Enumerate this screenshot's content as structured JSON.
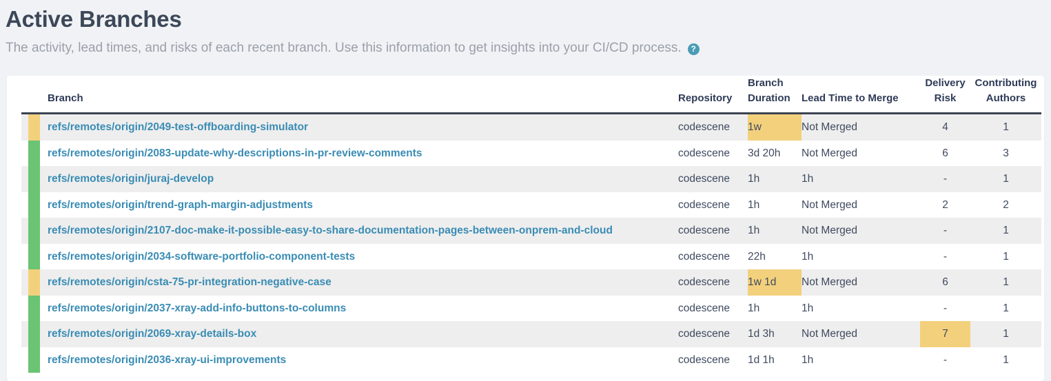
{
  "header": {
    "title": "Active Branches",
    "subtitle": "The activity, lead times, and risks of each recent branch. Use this information to get insights into your CI/CD process.",
    "help_icon": "help-circle-icon",
    "help_glyph": "?"
  },
  "colors": {
    "page_background": "#f1f2f6",
    "card_background": "#ffffff",
    "title": "#3c4858",
    "subtitle": "#9a9fa8",
    "link": "#3a8cb4",
    "header_text": "#2f3b57",
    "header_rule": "#3b4251",
    "status_amber": "#f3d07c",
    "status_green": "#6bc473",
    "highlight_amber": "#f3d07c",
    "row_odd": "#eeeeee",
    "row_even": "#ffffff",
    "help_icon": "#4a9cb5"
  },
  "table": {
    "columns": [
      {
        "key": "status",
        "label": ""
      },
      {
        "key": "branch",
        "label": "Branch"
      },
      {
        "key": "repository",
        "label": "Repository"
      },
      {
        "key": "branch_duration",
        "label": "Branch Duration"
      },
      {
        "key": "lead_time",
        "label": "Lead Time to Merge"
      },
      {
        "key": "delivery_risk",
        "label": "Delivery Risk"
      },
      {
        "key": "contributing_authors",
        "label": "Contributing Authors"
      }
    ],
    "rows": [
      {
        "status": "amber",
        "branch": "refs/remotes/origin/2049-test-offboarding-simulator",
        "repository": "codescene",
        "branch_duration": "1w",
        "branch_duration_highlighted": true,
        "lead_time": "Not Merged",
        "delivery_risk": "4",
        "delivery_risk_highlighted": false,
        "contributing_authors": "1"
      },
      {
        "status": "green",
        "branch": "refs/remotes/origin/2083-update-why-descriptions-in-pr-review-comments",
        "repository": "codescene",
        "branch_duration": "3d 20h",
        "branch_duration_highlighted": false,
        "lead_time": "Not Merged",
        "delivery_risk": "6",
        "delivery_risk_highlighted": false,
        "contributing_authors": "3"
      },
      {
        "status": "green",
        "branch": "refs/remotes/origin/juraj-develop",
        "repository": "codescene",
        "branch_duration": "1h",
        "branch_duration_highlighted": false,
        "lead_time": "1h",
        "delivery_risk": "-",
        "delivery_risk_highlighted": false,
        "contributing_authors": "1"
      },
      {
        "status": "green",
        "branch": "refs/remotes/origin/trend-graph-margin-adjustments",
        "repository": "codescene",
        "branch_duration": "1h",
        "branch_duration_highlighted": false,
        "lead_time": "Not Merged",
        "delivery_risk": "2",
        "delivery_risk_highlighted": false,
        "contributing_authors": "2"
      },
      {
        "status": "green",
        "branch": "refs/remotes/origin/2107-doc-make-it-possible-easy-to-share-documentation-pages-between-onprem-and-cloud",
        "repository": "codescene",
        "branch_duration": "1h",
        "branch_duration_highlighted": false,
        "lead_time": "Not Merged",
        "delivery_risk": "-",
        "delivery_risk_highlighted": false,
        "contributing_authors": "1"
      },
      {
        "status": "green",
        "branch": "refs/remotes/origin/2034-software-portfolio-component-tests",
        "repository": "codescene",
        "branch_duration": "22h",
        "branch_duration_highlighted": false,
        "lead_time": "1h",
        "delivery_risk": "-",
        "delivery_risk_highlighted": false,
        "contributing_authors": "1"
      },
      {
        "status": "amber",
        "branch": "refs/remotes/origin/csta-75-pr-integration-negative-case",
        "repository": "codescene",
        "branch_duration": "1w 1d",
        "branch_duration_highlighted": true,
        "lead_time": "Not Merged",
        "delivery_risk": "6",
        "delivery_risk_highlighted": false,
        "contributing_authors": "1"
      },
      {
        "status": "green",
        "branch": "refs/remotes/origin/2037-xray-add-info-buttons-to-columns",
        "repository": "codescene",
        "branch_duration": "1h",
        "branch_duration_highlighted": false,
        "lead_time": "1h",
        "delivery_risk": "-",
        "delivery_risk_highlighted": false,
        "contributing_authors": "1"
      },
      {
        "status": "green",
        "branch": "refs/remotes/origin/2069-xray-details-box",
        "repository": "codescene",
        "branch_duration": "1d 3h",
        "branch_duration_highlighted": false,
        "lead_time": "Not Merged",
        "delivery_risk": "7",
        "delivery_risk_highlighted": true,
        "contributing_authors": "1"
      },
      {
        "status": "green",
        "branch": "refs/remotes/origin/2036-xray-ui-improvements",
        "repository": "codescene",
        "branch_duration": "1d 1h",
        "branch_duration_highlighted": false,
        "lead_time": "1h",
        "delivery_risk": "-",
        "delivery_risk_highlighted": false,
        "contributing_authors": "1"
      }
    ]
  }
}
